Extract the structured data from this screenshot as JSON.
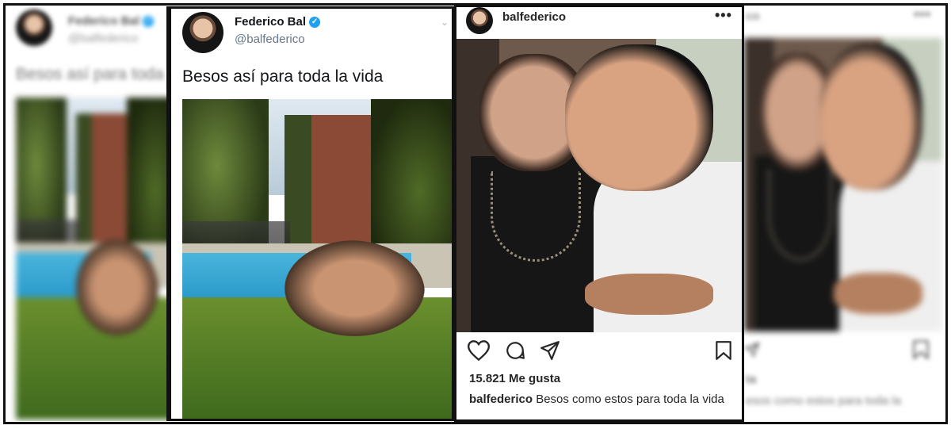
{
  "tweet": {
    "name": "Federico Bal",
    "handle": "@balfederico",
    "text": "Besos así para toda la vida",
    "left_text_partial": "Besos así para toda"
  },
  "instagram": {
    "username": "balfederico",
    "likes": "15.821 Me gusta",
    "caption_user": "balfederico",
    "caption_text": "Besos como estos para toda la vida",
    "right_caption_partial": "esos como estos para toda la",
    "right_likes_partial": "ta",
    "right_username_partial": "co"
  },
  "colors": {
    "verified": "#1da1f2",
    "frame_border": "#111111"
  },
  "icons": [
    "verified-icon",
    "chevron-down-icon",
    "more-dots-icon",
    "heart-icon",
    "comment-icon",
    "share-icon",
    "bookmark-icon"
  ]
}
